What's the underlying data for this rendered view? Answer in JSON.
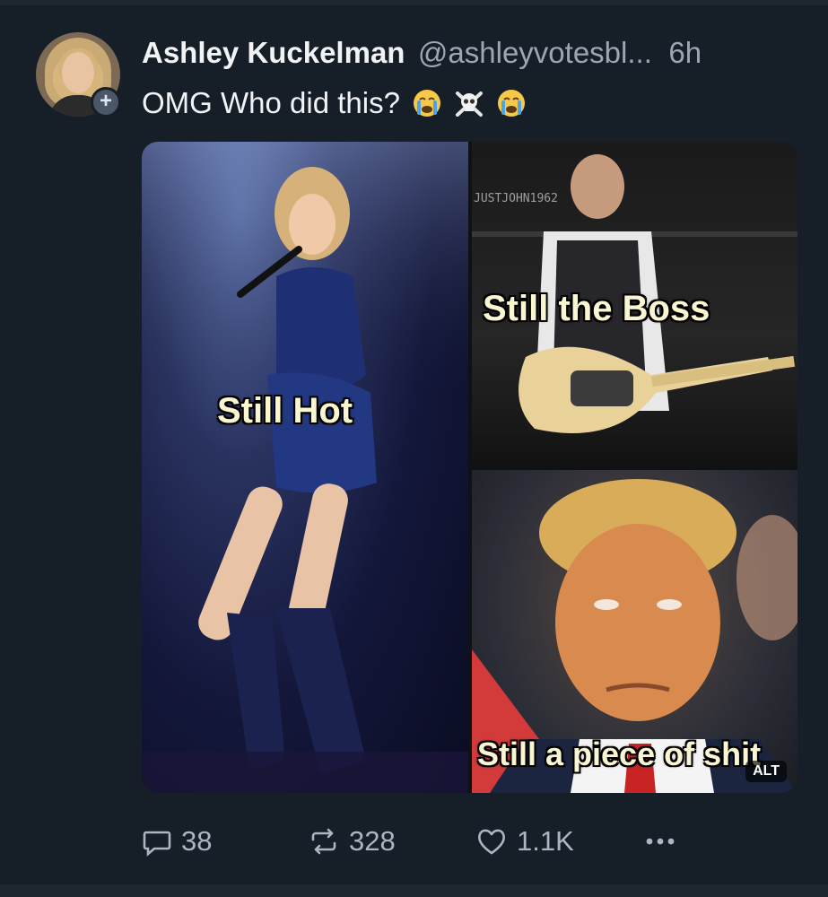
{
  "post": {
    "author_name": "Ashley Kuckelman",
    "author_handle": "@ashleyvotesbl...",
    "time_ago": "6h",
    "text": "OMG Who did this?",
    "emojis": [
      "loudly-crying-face-icon",
      "skull-and-crossbones-icon",
      "loudly-crying-face-icon"
    ]
  },
  "media": {
    "captions": {
      "left": "Still Hot",
      "top_right": "Still the Boss",
      "bottom_right": "Still a piece of shit"
    },
    "watermark": "JUSTJOHN1962",
    "alt_badge": "ALT"
  },
  "actions": {
    "replies": "38",
    "reposts": "328",
    "likes": "1.1K",
    "more_icon": "ellipsis-icon"
  },
  "colors": {
    "background": "#161e27",
    "text_primary": "#f1f3f5",
    "text_secondary": "#9aa7b5",
    "caption_text": "#fbf6d2"
  }
}
